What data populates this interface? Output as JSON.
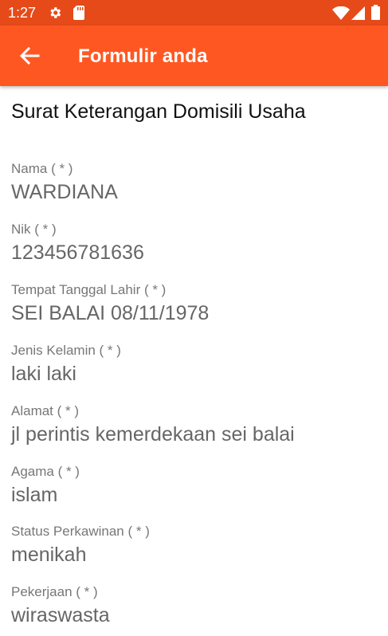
{
  "status_bar": {
    "time": "1:27"
  },
  "app_bar": {
    "title": "Formulir anda"
  },
  "form": {
    "title": "Surat Keterangan Domisili Usaha",
    "fields": [
      {
        "label": "Nama ( * )",
        "value": "WARDIANA"
      },
      {
        "label": "Nik ( * )",
        "value": "123456781636"
      },
      {
        "label": "Tempat Tanggal Lahir ( * )",
        "value": "SEI BALAI 08/11/1978"
      },
      {
        "label": "Jenis Kelamin ( * )",
        "value": "laki laki"
      },
      {
        "label": "Alamat ( * )",
        "value": "jl perintis kemerdekaan sei balai"
      },
      {
        "label": "Agama ( * )",
        "value": "islam"
      },
      {
        "label": "Status Perkawinan ( * )",
        "value": "menikah"
      },
      {
        "label": "Pekerjaan ( * )",
        "value": "wiraswasta"
      }
    ]
  },
  "colors": {
    "status_bar": "#e64a19",
    "app_bar": "#ff5722"
  },
  "icons": [
    "settings-icon",
    "sd-card-icon",
    "wifi-icon",
    "signal-icon",
    "battery-icon",
    "back-arrow-icon"
  ]
}
